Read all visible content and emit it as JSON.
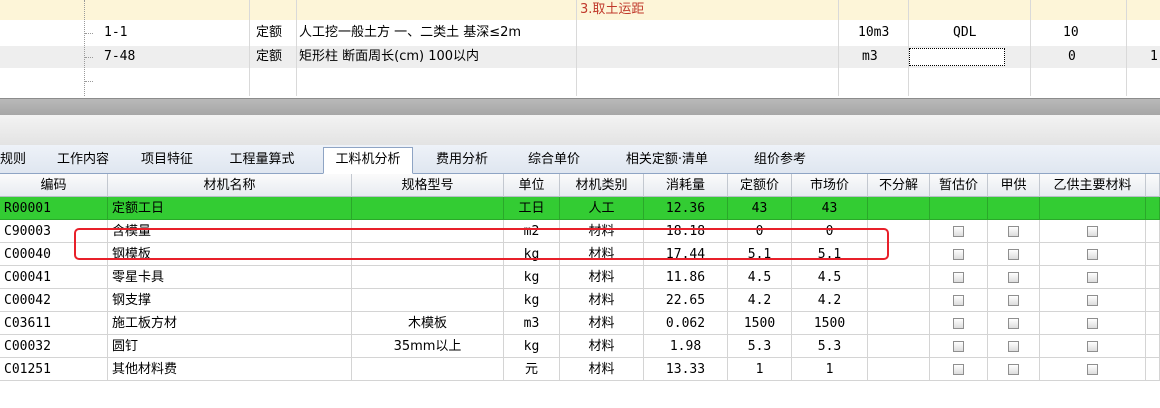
{
  "upper": {
    "top_note": "3.取土运距",
    "rows": [
      {
        "code": "1-1",
        "type": "定额",
        "name": "人工挖一般土方 一、二类土 基深≤2m",
        "unit": "10m3",
        "qty_expr": "QDL",
        "qty": "10"
      },
      {
        "code": "7-48",
        "type": "定额",
        "name": "矩形柱 断面周长(cm) 100以内",
        "unit": "m3",
        "qty_expr": "",
        "qty": "0",
        "extra": "1"
      }
    ]
  },
  "tabs": [
    {
      "label": "规则"
    },
    {
      "label": "工作内容"
    },
    {
      "label": "项目特征"
    },
    {
      "label": "工程量算式"
    },
    {
      "label": "工料机分析",
      "active": true
    },
    {
      "label": "费用分析"
    },
    {
      "label": "综合单价"
    },
    {
      "label": "相关定额·清单"
    },
    {
      "label": "组价参考"
    }
  ],
  "lower": {
    "headers": [
      "编码",
      "材机名称",
      "规格型号",
      "单位",
      "材机类别",
      "消耗量",
      "定额价",
      "市场价",
      "不分解",
      "暂估价",
      "甲供",
      "乙供主要材料"
    ],
    "rows": [
      {
        "code": "R00001",
        "name": "定额工日",
        "spec": "",
        "unit": "工日",
        "cat": "人工",
        "qty": "12.36",
        "quota": "43",
        "market": "43",
        "green": true
      },
      {
        "code": "C90003",
        "name": "含模量",
        "spec": "",
        "unit": "m2",
        "cat": "材料",
        "qty": "18.18",
        "quota": "0",
        "market": "0"
      },
      {
        "code": "C00040",
        "name": "钢模板",
        "spec": "",
        "unit": "kg",
        "cat": "材料",
        "qty": "17.44",
        "quota": "5.1",
        "market": "5.1"
      },
      {
        "code": "C00041",
        "name": "零星卡具",
        "spec": "",
        "unit": "kg",
        "cat": "材料",
        "qty": "11.86",
        "quota": "4.5",
        "market": "4.5"
      },
      {
        "code": "C00042",
        "name": "钢支撑",
        "spec": "",
        "unit": "kg",
        "cat": "材料",
        "qty": "22.65",
        "quota": "4.2",
        "market": "4.2"
      },
      {
        "code": "C03611",
        "name": "施工板方材",
        "spec": "木模板",
        "unit": "m3",
        "cat": "材料",
        "qty": "0.062",
        "quota": "1500",
        "market": "1500"
      },
      {
        "code": "C00032",
        "name": "圆钉",
        "spec": "35mm以上",
        "unit": "kg",
        "cat": "材料",
        "qty": "1.98",
        "quota": "5.3",
        "market": "5.3"
      },
      {
        "code": "C01251",
        "name": "其他材料费",
        "spec": "",
        "unit": "元",
        "cat": "材料",
        "qty": "13.33",
        "quota": "1",
        "market": "1"
      }
    ]
  },
  "colors": {
    "labor_row": "#33cc33",
    "highlight": "#e8202a",
    "note_text": "#c0392b",
    "note_bg": "#fdf5d8"
  }
}
